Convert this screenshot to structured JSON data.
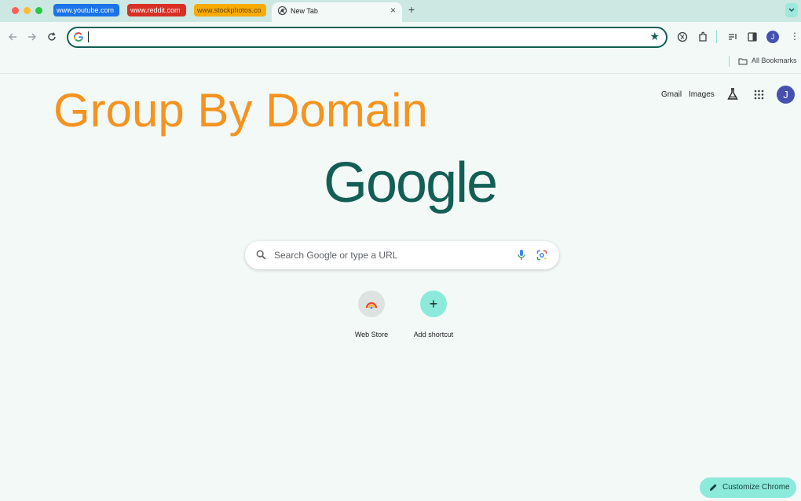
{
  "tab_groups": [
    {
      "label": "www.youtube.com",
      "color": "#1a73e8"
    },
    {
      "label": "www.reddit.com",
      "color": "#d93025"
    },
    {
      "label": "www.stockphotos.co",
      "color": "#f9ab00"
    }
  ],
  "active_tab": {
    "title": "New Tab"
  },
  "bookmarks": {
    "all_bookmarks_label": "All Bookmarks"
  },
  "overlay": {
    "title": "Group By Domain",
    "color": "#f5931f"
  },
  "top_links": {
    "gmail": "Gmail",
    "images": "Images"
  },
  "avatar_letter": "J",
  "logo": "Google",
  "search": {
    "placeholder": "Search Google or type a URL"
  },
  "shortcuts": [
    {
      "label": "Web Store"
    },
    {
      "label": "Add shortcut",
      "icon_glyph": "+"
    }
  ],
  "customize": {
    "label": "Customize Chrome"
  },
  "colors": {
    "accent": "#0f5f53",
    "mint": "#8ceadb",
    "tabstrip": "#cde8e2"
  }
}
